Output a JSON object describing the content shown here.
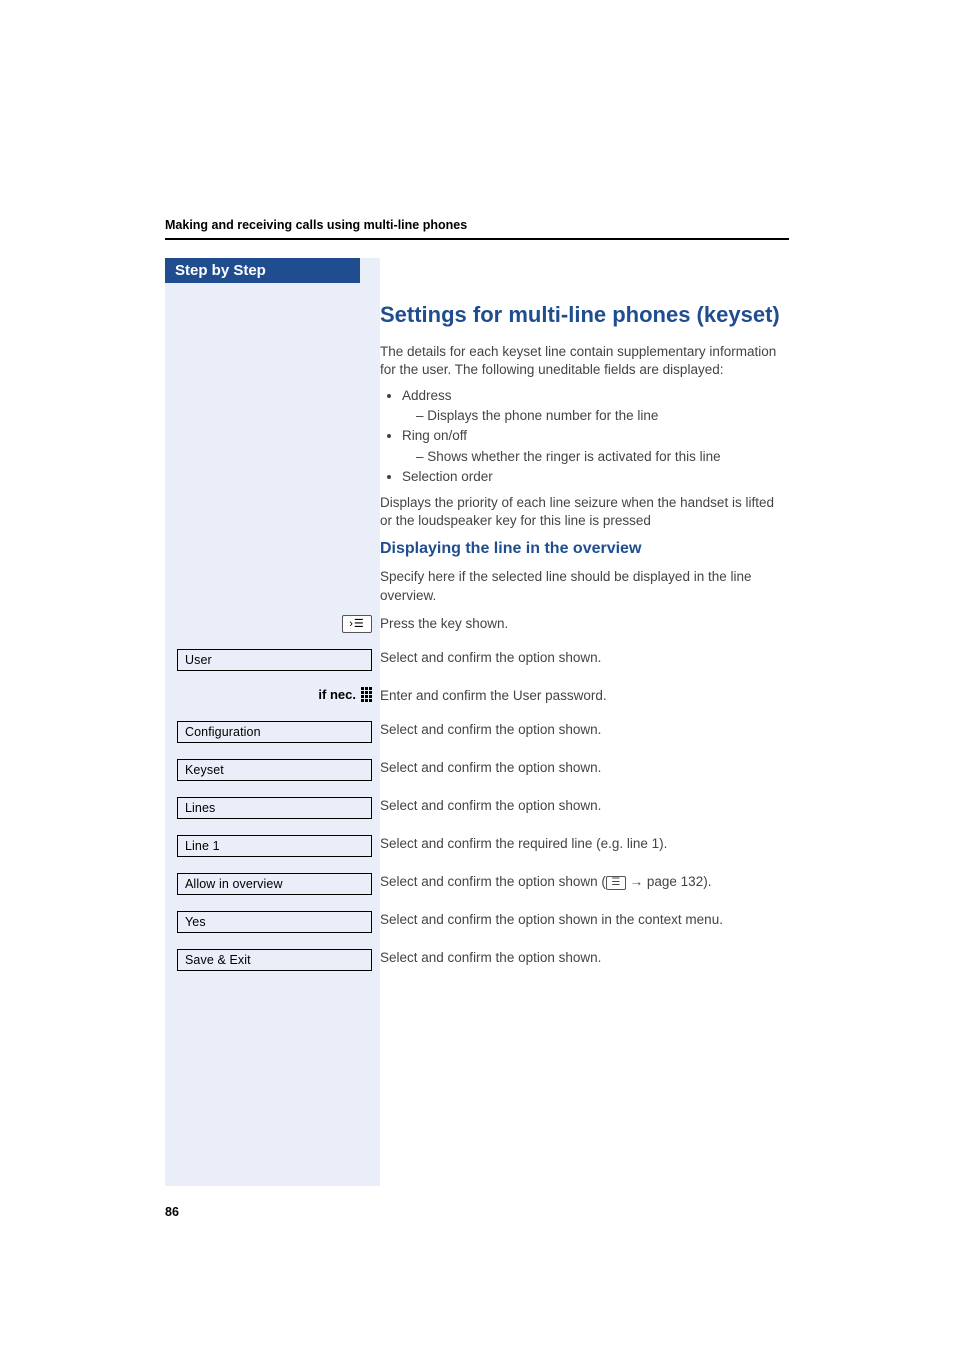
{
  "running_header": "Making and receiving calls using multi-line phones",
  "step_by_step": "Step by Step",
  "section_title": "Settings for multi-line phones (keyset)",
  "intro_p1": "The details for each keyset line contain supplementary information for the user. The following uneditable fields are displayed:",
  "bullets": [
    {
      "label": "Address",
      "sub": "Displays the phone number for the line"
    },
    {
      "label": "Ring on/off",
      "sub": "Shows whether the ringer is activated for this line"
    },
    {
      "label": "Selection order",
      "sub": null
    }
  ],
  "intro_p2": "Displays the priority of each line seizure when the handset is lifted or the loudspeaker key for this line is pressed",
  "subsection_title": "Displaying the line in the overview",
  "sub_p1": "Specify here if the selected line should be displayed in the line overview.",
  "steps": {
    "press_key": "Press the key shown.",
    "user_box": "User",
    "user_text": "Select and confirm the option shown.",
    "ifnec_label": "if nec.",
    "ifnec_text": "Enter and confirm the User password.",
    "config_box": "Configuration",
    "config_text": "Select and confirm the option shown.",
    "keyset_box": "Keyset",
    "keyset_text": "Select and confirm the option shown.",
    "lines_box": "Lines",
    "lines_text": "Select and confirm the option shown.",
    "line1_box": "Line 1",
    "line1_text": "Select and confirm the required line (e.g. line 1).",
    "allow_box": "Allow in overview",
    "allow_text_pre": "Select and confirm the option shown (",
    "allow_text_post": " page 132).",
    "yes_box": "Yes",
    "yes_text": "Select and confirm the option shown in the context menu.",
    "save_box": "Save & Exit",
    "save_text": "Select and confirm the option shown."
  },
  "page_number": "86"
}
